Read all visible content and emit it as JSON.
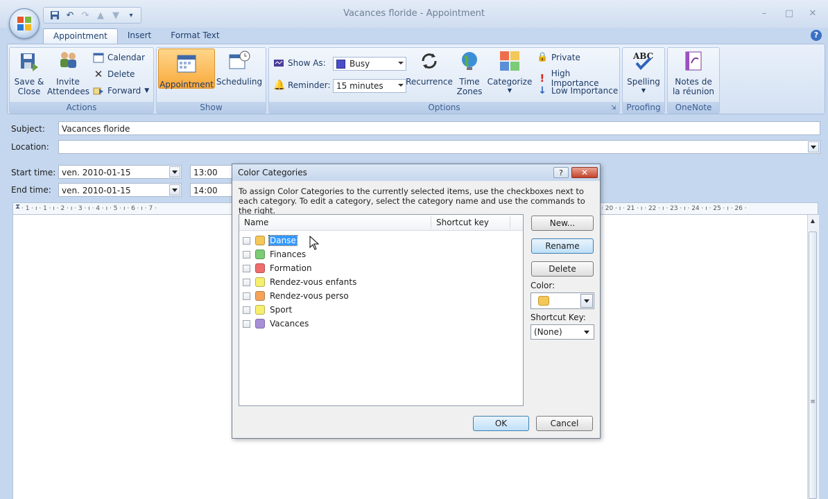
{
  "window": {
    "title": "Vacances floride - Appointment",
    "controls": {
      "minimize": "–",
      "maximize": "□",
      "close": "✕"
    },
    "qat_icons": [
      "save-icon",
      "undo-icon",
      "redo-icon",
      "previous-icon",
      "next-icon",
      "customize-icon"
    ]
  },
  "tabs": [
    {
      "label": "Appointment",
      "active": true
    },
    {
      "label": "Insert",
      "active": false
    },
    {
      "label": "Format Text",
      "active": false
    }
  ],
  "help_glyph": "?",
  "ribbon": {
    "actions": {
      "label": "Actions",
      "save_close": "Save &\nClose",
      "invite": "Invite\nAttendees",
      "calendar": "Calendar",
      "delete": "Delete",
      "forward": "Forward"
    },
    "show": {
      "label": "Show",
      "appointment": "Appointment",
      "scheduling": "Scheduling"
    },
    "options": {
      "label": "Options",
      "show_as_label": "Show As:",
      "show_as_value": "Busy",
      "reminder_label": "Reminder:",
      "reminder_value": "15 minutes",
      "recurrence": "Recurrence",
      "time_zones": "Time\nZones",
      "categorize": "Categorize",
      "private": "Private",
      "high_importance": "High Importance",
      "low_importance": "Low Importance"
    },
    "proofing": {
      "label": "Proofing",
      "spelling": "Spelling"
    },
    "onenote": {
      "label": "OneNote",
      "notes": "Notes de\nla réunion"
    }
  },
  "form": {
    "subject_label": "Subject:",
    "subject_value": "Vacances floride",
    "location_label": "Location:",
    "location_value": "",
    "start_label": "Start time:",
    "start_date": "ven. 2010-01-15",
    "start_time": "13:00",
    "end_label": "End time:",
    "end_date": "ven. 2010-01-15",
    "end_time": "14:00"
  },
  "ruler": {
    "left": "· 1 · ı · 1 · ı · 2 · ı · 3 · ı · 4 · ı · 5 · ı · 6 · ı · 7 ·",
    "right": "· 20 · ı · 21 · ı · 22 · ı · 23 · ı · 24 · ı · 25 · ı · 26 ·"
  },
  "dialog": {
    "title": "Color Categories",
    "help_glyph": "?",
    "close_glyph": "✕",
    "instructions": "To assign Color Categories to the currently selected items, use the checkboxes next to each category.  To edit a category, select the category name and use the commands to the right.",
    "columns": {
      "name": "Name",
      "shortcut": "Shortcut key"
    },
    "categories": [
      {
        "name": "Danse",
        "color": "#f3c758",
        "selected": true
      },
      {
        "name": "Finances",
        "color": "#7ccb76",
        "selected": false
      },
      {
        "name": "Formation",
        "color": "#ee6e6e",
        "selected": false
      },
      {
        "name": "Rendez-vous enfants",
        "color": "#f6ee6e",
        "selected": false
      },
      {
        "name": "Rendez-vous perso",
        "color": "#f4a45a",
        "selected": false
      },
      {
        "name": "Sport",
        "color": "#f6ee6e",
        "selected": false
      },
      {
        "name": "Vacances",
        "color": "#a98fd9",
        "selected": false
      }
    ],
    "buttons": {
      "new": "New...",
      "rename": "Rename",
      "delete": "Delete",
      "ok": "OK",
      "cancel": "Cancel"
    },
    "color_label": "Color:",
    "color_value": "#f3c758",
    "shortcut_key_label": "Shortcut Key:",
    "shortcut_key_value": "(None)"
  }
}
